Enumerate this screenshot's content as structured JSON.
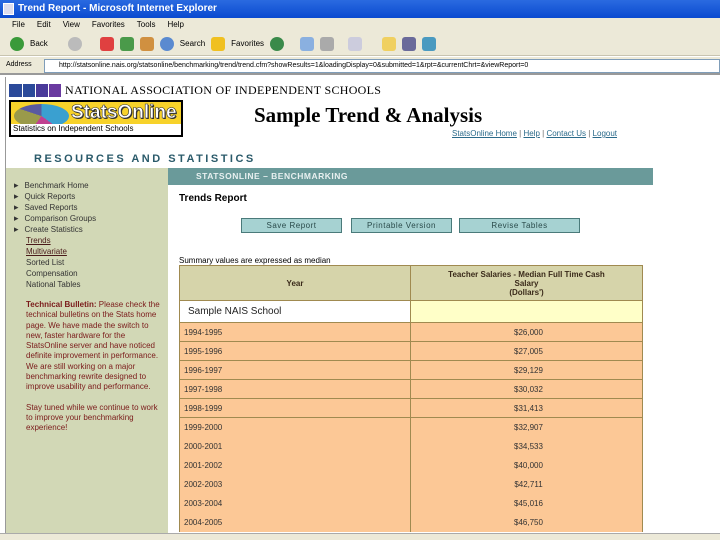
{
  "window": {
    "title": "Trend Report - Microsoft Internet Explorer"
  },
  "menu": [
    "File",
    "Edit",
    "View",
    "Favorites",
    "Tools",
    "Help"
  ],
  "toolbar": {
    "back": "Back",
    "search": "Search",
    "favorites": "Favorites"
  },
  "address": {
    "label": "Address",
    "url": "http://statsonline.nais.org/statsonline/benchmarking/trend/trend.cfm?showResults=1&loadingDisplay=0&submitted=1&rpt=&currentChrt=&viewReport=0"
  },
  "header": {
    "org": "NATIONAL ASSOCIATION OF INDEPENDENT SCHOOLS",
    "logo_name": "StatsOnline",
    "logo_sub": "Statistics on Independent Schools",
    "headline": "Sample Trend & Analysis",
    "links": [
      "StatsOnline Home",
      "Help",
      "Contact Us",
      "Logout"
    ],
    "section": "RESOURCES AND STATISTICS"
  },
  "sidebar": {
    "nav": [
      "Benchmark Home",
      "Quick Reports",
      "Saved Reports",
      "Comparison Groups",
      "Create Statistics"
    ],
    "sub": [
      "Trends",
      "Multivariate",
      "Sorted List",
      "Compensation",
      "National Tables"
    ],
    "bulletin_title": "Technical Bulletin:",
    "bulletin_text": " Please check the technical bulletins on the Stats home page. We have made the switch to new, faster hardware for the StatsOnline server and have noticed definite improvement in performance. We are still working on a major benchmarking rewrite designed to improve usability and performance.",
    "bulletin_more": "Stay tuned while we continue to work to improve your benchmarking experience!"
  },
  "main": {
    "bar": "STATSONLINE – BENCHMARKING",
    "title": "Trends Report",
    "buttons": [
      "Save Report",
      "Printable Version",
      "Revise Tables"
    ],
    "summary": "Summary values are expressed as median",
    "table": {
      "col1": "Year",
      "col2_l1": "Teacher Salaries - Median Full Time Cash",
      "col2_l2": "Salary",
      "col2_l3": "(Dollars')",
      "school": "Sample NAIS School",
      "rows": [
        [
          "1994-1995",
          "$26,000"
        ],
        [
          "1995-1996",
          "$27,005"
        ],
        [
          "1996-1997",
          "$29,129"
        ],
        [
          "1997-1998",
          "$30,032"
        ],
        [
          "1998-1999",
          "$31,413"
        ],
        [
          "1999-2000",
          "$32,907"
        ],
        [
          "2000-2001",
          "$34,533"
        ],
        [
          "2001-2002",
          "$40,000"
        ],
        [
          "2002-2003",
          "$42,711"
        ],
        [
          "2003-2004",
          "$45,016"
        ],
        [
          "2004-2005",
          "$46,750"
        ]
      ]
    }
  }
}
